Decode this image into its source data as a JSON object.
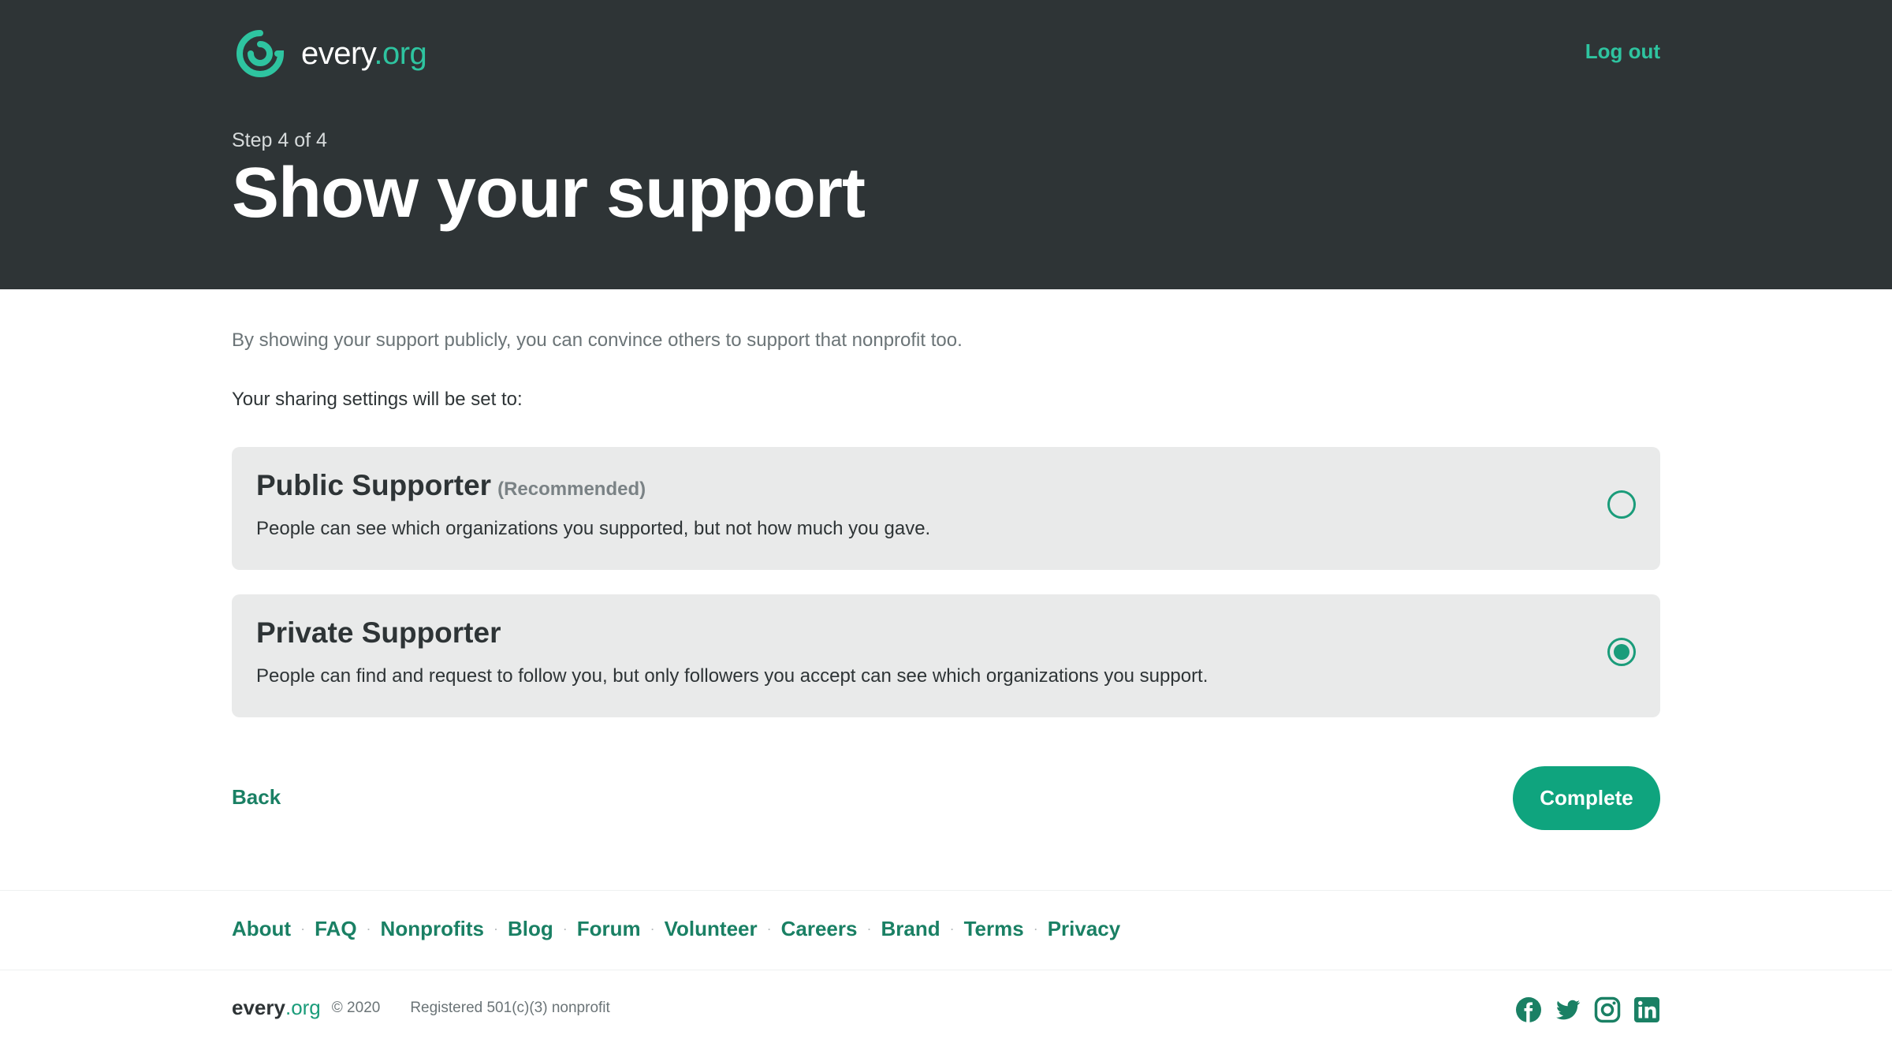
{
  "brand": {
    "name_main": "every",
    "name_accent": ".org",
    "accent_color": "#2ec4a0",
    "dark_bg": "#2e3436"
  },
  "header": {
    "logout_label": "Log out",
    "step": "Step 4 of 4",
    "title": "Show your support"
  },
  "main": {
    "intro": "By showing your support publicly, you can convince others to support that nonprofit too.",
    "sharing_label": "Your sharing settings will be set to:",
    "options": [
      {
        "title": "Public Supporter",
        "tag": "(Recommended)",
        "description": "People can see which organizations you supported, but not how much you gave.",
        "selected": false
      },
      {
        "title": "Private Supporter",
        "tag": "",
        "description": "People can find and request to follow you, but only followers you accept can see which organizations you support.",
        "selected": true
      }
    ],
    "back_label": "Back",
    "complete_label": "Complete"
  },
  "footer": {
    "nav": [
      "About",
      "FAQ",
      "Nonprofits",
      "Blog",
      "Forum",
      "Volunteer",
      "Careers",
      "Brand",
      "Terms",
      "Privacy"
    ],
    "separator": "·",
    "copyright": "© 2020",
    "registered": "Registered 501(c)(3) nonprofit",
    "socials": [
      "facebook-icon",
      "twitter-icon",
      "instagram-icon",
      "linkedin-icon"
    ]
  }
}
